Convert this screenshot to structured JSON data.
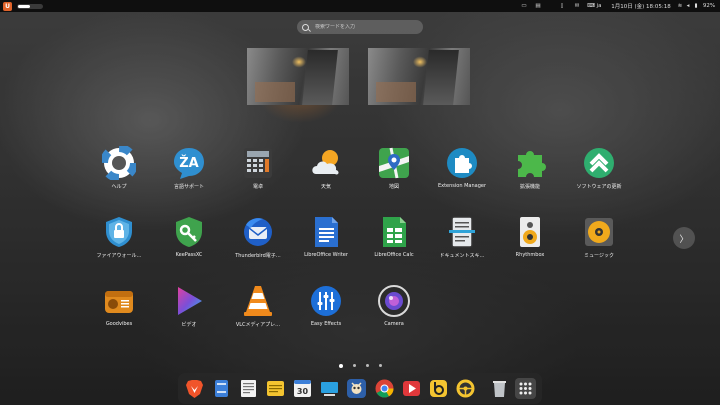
{
  "topbar": {
    "language": "ja",
    "clock": "1月10日 (金) 18:05:18",
    "battery": "92%",
    "brand_color": "#e0632a"
  },
  "search": {
    "placeholder": "検索ワードを入力"
  },
  "apps": [
    {
      "label": "ヘルプ",
      "icon": "lifebuoy-icon"
    },
    {
      "label": "言語サポート",
      "icon": "language-support-icon"
    },
    {
      "label": "電卓",
      "icon": "calculator-icon"
    },
    {
      "label": "天気",
      "icon": "weather-icon"
    },
    {
      "label": "地図",
      "icon": "maps-icon"
    },
    {
      "label": "Extension Manager",
      "icon": "extension-manager-icon"
    },
    {
      "label": "拡張機能",
      "icon": "extensions-puzzle-icon"
    },
    {
      "label": "ソフトウェアの更新",
      "icon": "software-updater-icon"
    },
    {
      "label": "ファイアウォール…",
      "icon": "firewall-shield-icon"
    },
    {
      "label": "KeePassXC",
      "icon": "keepassxc-icon"
    },
    {
      "label": "Thunderbird電子…",
      "icon": "thunderbird-icon"
    },
    {
      "label": "LibreOffice Writer",
      "icon": "libreoffice-writer-icon"
    },
    {
      "label": "LibreOffice Calc",
      "icon": "libreoffice-calc-icon"
    },
    {
      "label": "ドキュメントスキ…",
      "icon": "document-scanner-icon"
    },
    {
      "label": "Rhythmbox",
      "icon": "rhythmbox-icon"
    },
    {
      "label": "ミュージック",
      "icon": "music-icon"
    },
    {
      "label": "Goodvibes",
      "icon": "goodvibes-radio-icon"
    },
    {
      "label": "ビデオ",
      "icon": "videos-icon"
    },
    {
      "label": "VLCメディアプレ…",
      "icon": "vlc-icon"
    },
    {
      "label": "Easy Effects",
      "icon": "easy-effects-icon"
    },
    {
      "label": "Camera",
      "icon": "camera-icon"
    }
  ],
  "pager": {
    "pages": 4,
    "current": 1
  },
  "calendar_day": "30",
  "dock": [
    "brave-icon",
    "files-icon",
    "text-editor-icon",
    "notes-icon",
    "calendar-icon",
    "desktop-icon",
    "gimp-icon",
    "chrome-icon",
    "media-player-icon",
    "beeper-icon",
    "steering-wheel-icon",
    "trash-icon",
    "app-grid-icon"
  ]
}
